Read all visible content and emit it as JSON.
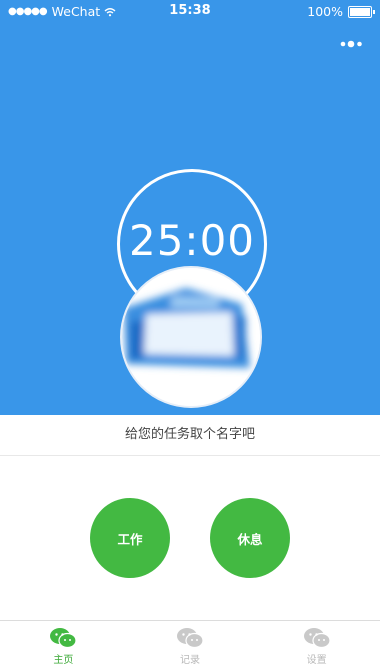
{
  "status_bar": {
    "carrier": "WeChat",
    "time": "15:38",
    "battery": "100%"
  },
  "timer": {
    "display": "25:00"
  },
  "task": {
    "placeholder_text": "给您的任务取个名字吧"
  },
  "buttons": {
    "work": "工作",
    "rest": "休息"
  },
  "tabs": [
    {
      "label": "主页",
      "icon": "wechat-icon",
      "active": true
    },
    {
      "label": "记录",
      "icon": "wechat-icon",
      "active": false
    },
    {
      "label": "设置",
      "icon": "wechat-icon",
      "active": false
    }
  ],
  "colors": {
    "header_blue": "#3996e9",
    "button_green": "#43b942",
    "tab_active_green": "#3aa835",
    "tab_inactive_gray": "#b9b9b9"
  }
}
